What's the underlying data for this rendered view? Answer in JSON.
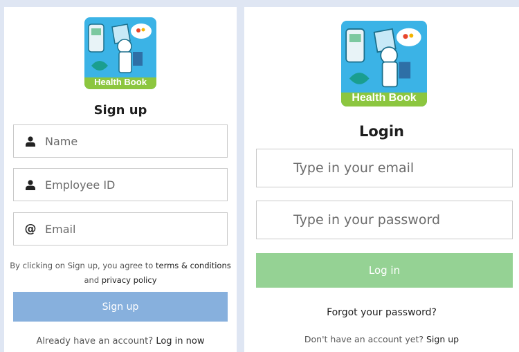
{
  "signup": {
    "logo_label": "Health Book",
    "title": "Sign up",
    "name_placeholder": "Name",
    "employee_id_placeholder": "Employee ID",
    "email_placeholder": "Email",
    "terms_prefix": "By clicking on Sign up, you agree to",
    "terms_link": "terms & conditions",
    "and_text": "and",
    "privacy_link": "privacy policy",
    "button_label": "Sign up",
    "footer_prefix": "Already have an account?",
    "footer_link": "Log in now",
    "button_color": "#87b0dd"
  },
  "login": {
    "logo_label": "Health Book",
    "title": "Login",
    "email_placeholder": "Type in your email",
    "password_placeholder": "Type in your password",
    "button_label": "Log in",
    "forgot_link": "Forgot your password?",
    "footer_prefix": "Don't have an account yet?",
    "footer_link": "Sign up",
    "button_color": "#95d294"
  },
  "icons": {
    "name_field": "user-icon",
    "employee_field": "user-icon",
    "email_field": "at-icon"
  }
}
